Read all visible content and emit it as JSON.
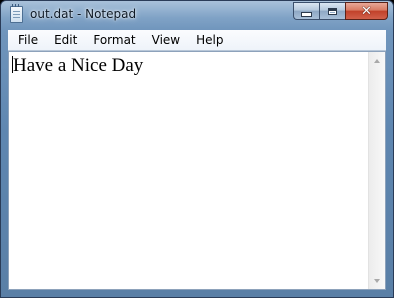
{
  "window": {
    "title": "out.dat - Notepad",
    "icon": "notepad-icon",
    "controls": {
      "minimize_icon": "minimize-icon",
      "maximize_icon": "maximize-icon",
      "close_icon": "close-icon",
      "close_glyph": "✕"
    }
  },
  "menu": {
    "items": [
      {
        "label": "File"
      },
      {
        "label": "Edit"
      },
      {
        "label": "Format"
      },
      {
        "label": "View"
      },
      {
        "label": "Help"
      }
    ]
  },
  "editor": {
    "content": "Have a Nice Day"
  },
  "colors": {
    "frame_accent": "#6f94bb",
    "close_button": "#c1412a",
    "editor_background": "#ffffff"
  }
}
